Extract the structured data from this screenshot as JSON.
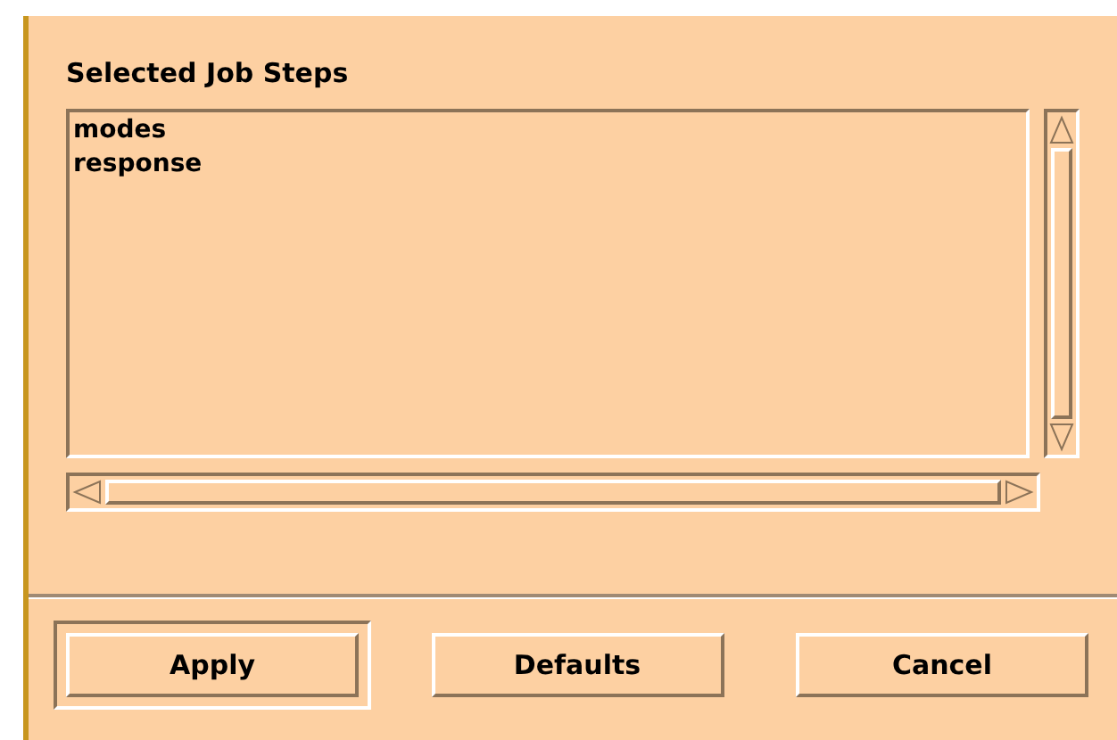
{
  "section_label": "Selected Job Steps",
  "list_items": [
    {
      "label": "modes",
      "selected": false
    },
    {
      "label": "response",
      "selected": false
    }
  ],
  "buttons": [
    {
      "label": "Apply",
      "default": true
    },
    {
      "label": "Defaults",
      "default": false
    },
    {
      "label": "Cancel",
      "default": false
    }
  ]
}
